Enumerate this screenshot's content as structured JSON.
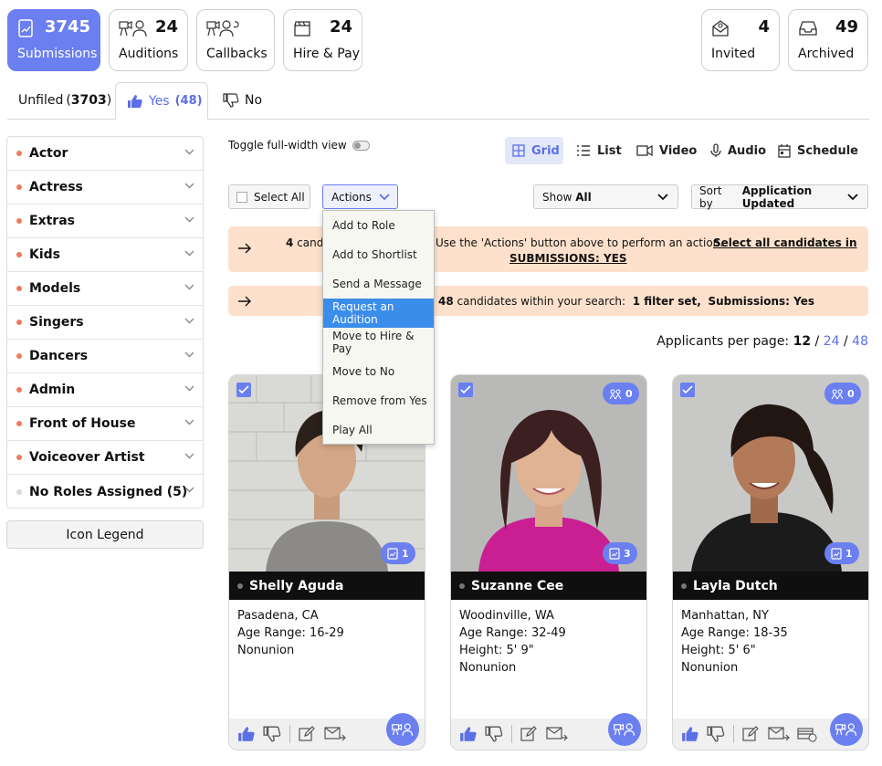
{
  "tiles": {
    "submissions": {
      "count": "3745",
      "label": "Submissions"
    },
    "auditions": {
      "count": "24",
      "label": "Auditions"
    },
    "callbacks": {
      "count": "",
      "label": "Callbacks"
    },
    "hire_pay": {
      "count": "24",
      "label": "Hire & Pay"
    },
    "invited": {
      "count": "4",
      "label": "Invited"
    },
    "archived": {
      "count": "49",
      "label": "Archived"
    }
  },
  "tabs": {
    "unfiled": {
      "label": "Unfiled",
      "count": "3703"
    },
    "yes": {
      "label": "Yes",
      "count": "(48)"
    },
    "no": {
      "label": "No"
    }
  },
  "sidebar": {
    "items": [
      {
        "label": "Actor"
      },
      {
        "label": "Actress"
      },
      {
        "label": "Extras"
      },
      {
        "label": "Kids"
      },
      {
        "label": "Models"
      },
      {
        "label": "Singers"
      },
      {
        "label": "Dancers"
      },
      {
        "label": "Admin"
      },
      {
        "label": "Front of House"
      },
      {
        "label": "Voiceover Artist"
      },
      {
        "label": "No Roles Assigned (5)"
      }
    ],
    "legend_label": "Icon Legend"
  },
  "toolbar": {
    "toggle_label": "Toggle full-width view",
    "views": [
      "Grid",
      "List",
      "Video",
      "Audio",
      "Schedule"
    ],
    "select_all": "Select All",
    "actions": "Actions",
    "show_prefix": "Show",
    "show_value": "All",
    "sort_prefix": "Sort by",
    "sort_value": "Application Updated"
  },
  "actions_menu": [
    "Add to Role",
    "Add to Shortlist",
    "Send a Message",
    "Request an Audition",
    "Move to Hire & Pay",
    "Move to No",
    "Remove from Yes",
    "Play All"
  ],
  "banners": {
    "b1_count": "4",
    "b1_text_a": "cand",
    "b1_text_b": "Use the 'Actions' button above to perform an action.",
    "b1_link_a": "Select all candidates in",
    "b1_link_b": "SUBMISSIONS: YES",
    "b2_count": "48",
    "b2_text": "candidates within your search:",
    "b2_filter": "1 filter set,",
    "b2_sub": "Submissions: Yes"
  },
  "paging": {
    "label": "Applicants per page:",
    "current": "12",
    "opt2": "24",
    "opt3": "48",
    "sep": "/"
  },
  "cards": [
    {
      "name": "Shelly Aguda",
      "lines": [
        "Pasadena, CA",
        "Age Range: 16-29",
        "Nonunion"
      ],
      "sub_count": "1",
      "aud_count": ""
    },
    {
      "name": "Suzanne Cee",
      "lines": [
        "Woodinville, WA",
        "Age Range: 32-49",
        "Height: 5' 9\"",
        "Nonunion"
      ],
      "sub_count": "3",
      "aud_count": "0"
    },
    {
      "name": "Layla Dutch",
      "lines": [
        "Manhattan, NY",
        "Age Range: 18-35",
        "Height: 5' 6\"",
        "Nonunion"
      ],
      "sub_count": "1",
      "aud_count": "0"
    }
  ],
  "colors": {
    "accent": "#6b7ff0",
    "banner": "#fde1cc",
    "dot": "#f07a5a",
    "highlight": "#3b8dea"
  }
}
